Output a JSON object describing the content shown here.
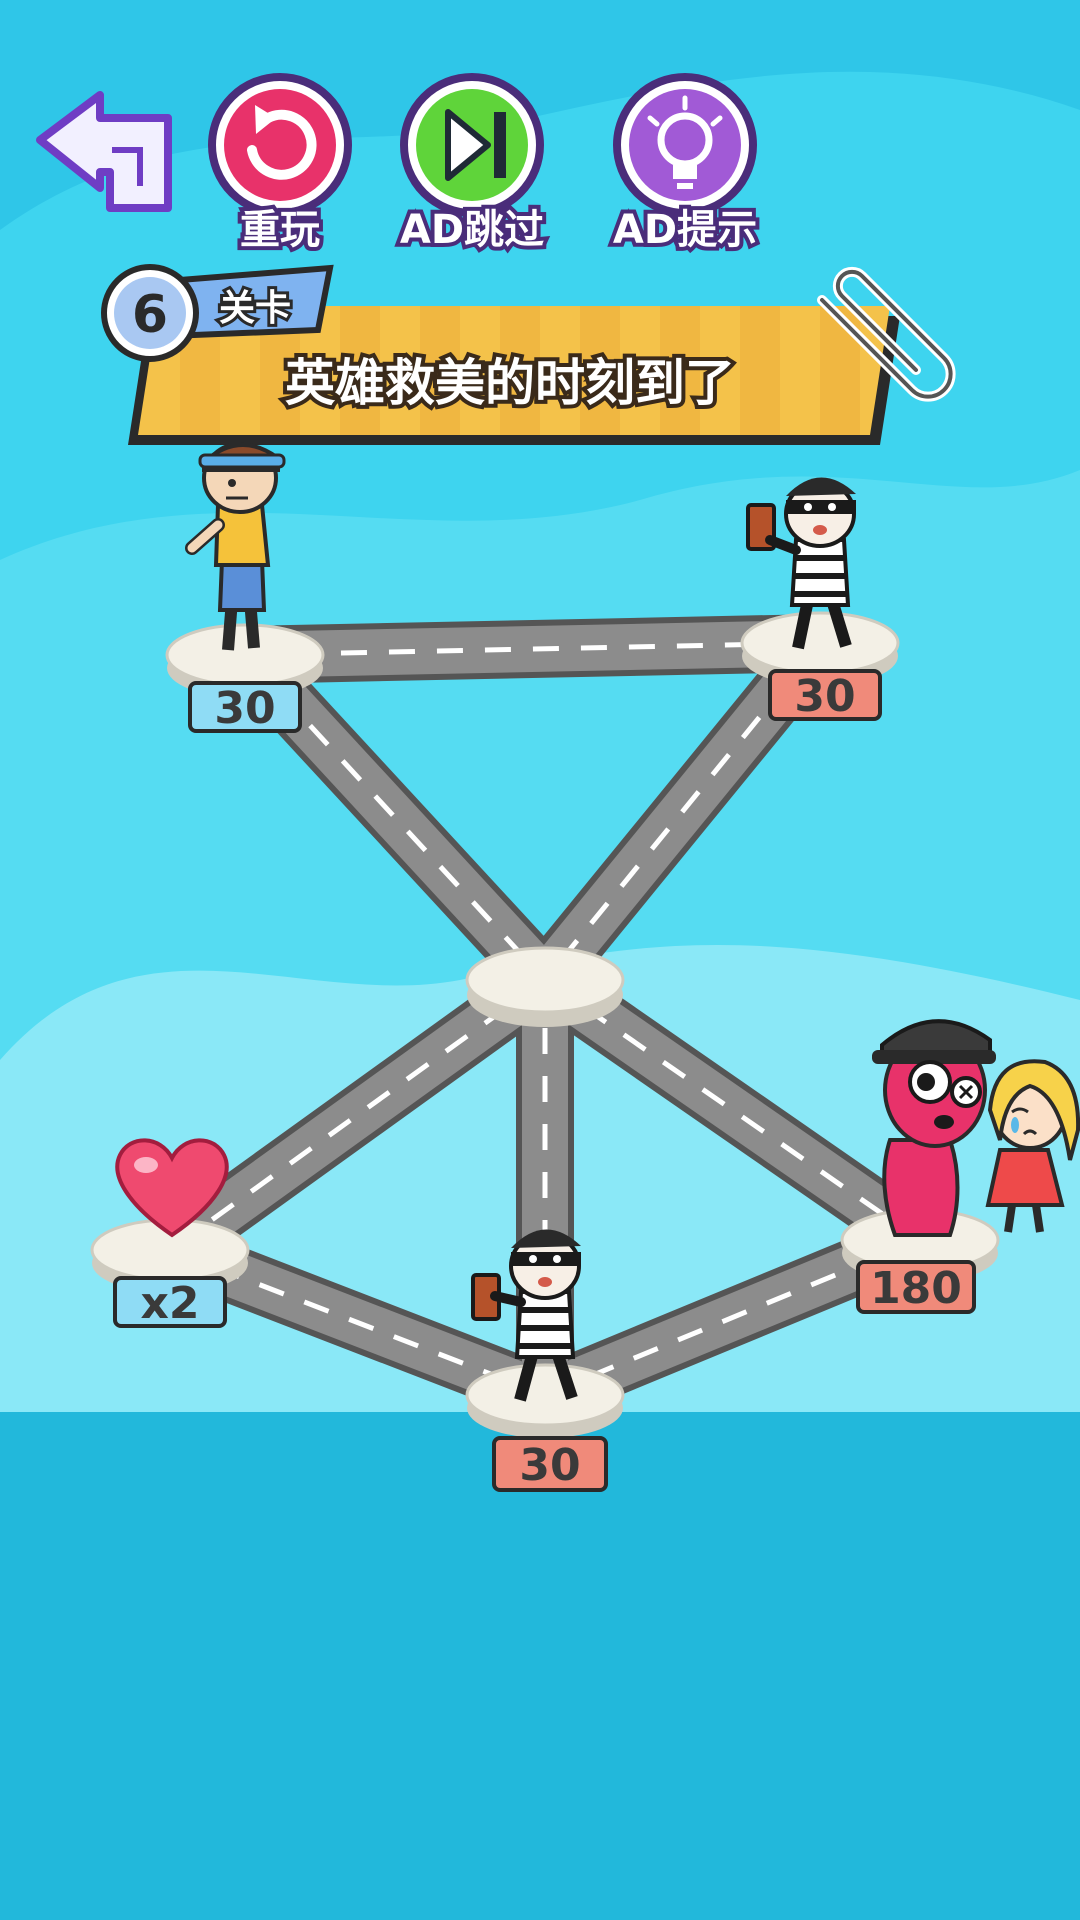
{
  "toolbar": {
    "back_icon": "back-arrow-icon",
    "replay_label": "重玩",
    "replay_icon": "replay-icon",
    "skip_label": "AD跳过",
    "skip_icon": "skip-forward-icon",
    "hint_label": "AD提示",
    "hint_icon": "lightbulb-icon"
  },
  "level": {
    "number": "6",
    "tag": "关卡",
    "title": "英雄救美的时刻到了"
  },
  "nodes": {
    "hero": {
      "value": "30"
    },
    "thief_top": {
      "value": "30"
    },
    "heart": {
      "value": "x2"
    },
    "thief_bottom": {
      "value": "30"
    },
    "boss": {
      "value": "180"
    }
  },
  "colors": {
    "sky": "#2fc6e8",
    "water": "#22b8db",
    "friendly_tag": "#8fdcf5",
    "enemy_tag": "#f08a7a",
    "road": "#8c8c8c",
    "replay": "#e8326a",
    "skip": "#5fd43a",
    "hint": "#a15ad6"
  }
}
